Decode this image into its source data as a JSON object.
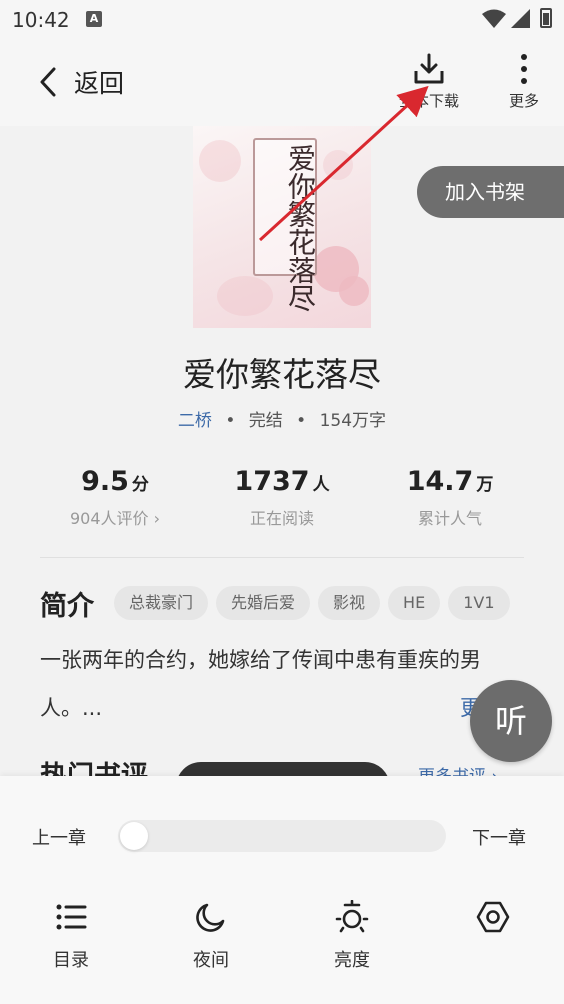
{
  "status": {
    "time": "10:42",
    "notif_icon": "A"
  },
  "header": {
    "back_label": "返回",
    "download_label": "全本下载",
    "more_label": "更多"
  },
  "book": {
    "cover_title": "爱你繁花落尽",
    "title": "爱你繁花落尽",
    "author": "二桥",
    "status": "完结",
    "words": "154万字",
    "add_shelf": "加入书架"
  },
  "stats": [
    {
      "value": "9.5",
      "unit": "分",
      "label": "904人评价 ›"
    },
    {
      "value": "1737",
      "unit": "人",
      "label": "正在阅读"
    },
    {
      "value": "14.7",
      "unit": "万",
      "label": "累计人气"
    }
  ],
  "intro": {
    "heading": "简介",
    "tags": [
      "总裁豪门",
      "先婚后爱",
      "影视",
      "HE",
      "1V1"
    ],
    "text": "一张两年的合约，她嫁给了传闻中患有重疾的男人。...",
    "more": "更"
  },
  "listen_label": "听",
  "reviews": {
    "heading": "热门书评",
    "more": "更多书评 ›"
  },
  "reader": {
    "prev": "上一章",
    "next": "下一章",
    "progress": 0,
    "tools": [
      {
        "label": "目录",
        "icon": "list-icon"
      },
      {
        "label": "夜间",
        "icon": "moon-icon"
      },
      {
        "label": "亮度",
        "icon": "brightness-icon"
      },
      {
        "label": "设置",
        "icon": "hexagon-settings-icon"
      }
    ]
  },
  "tool_labels": {
    "catalog": "目录",
    "night": "夜间",
    "brightness": "亮度"
  },
  "colors": {
    "link": "#3d6aa8",
    "annotation_arrow": "#d9282f",
    "pill": "#6e6e6e"
  }
}
